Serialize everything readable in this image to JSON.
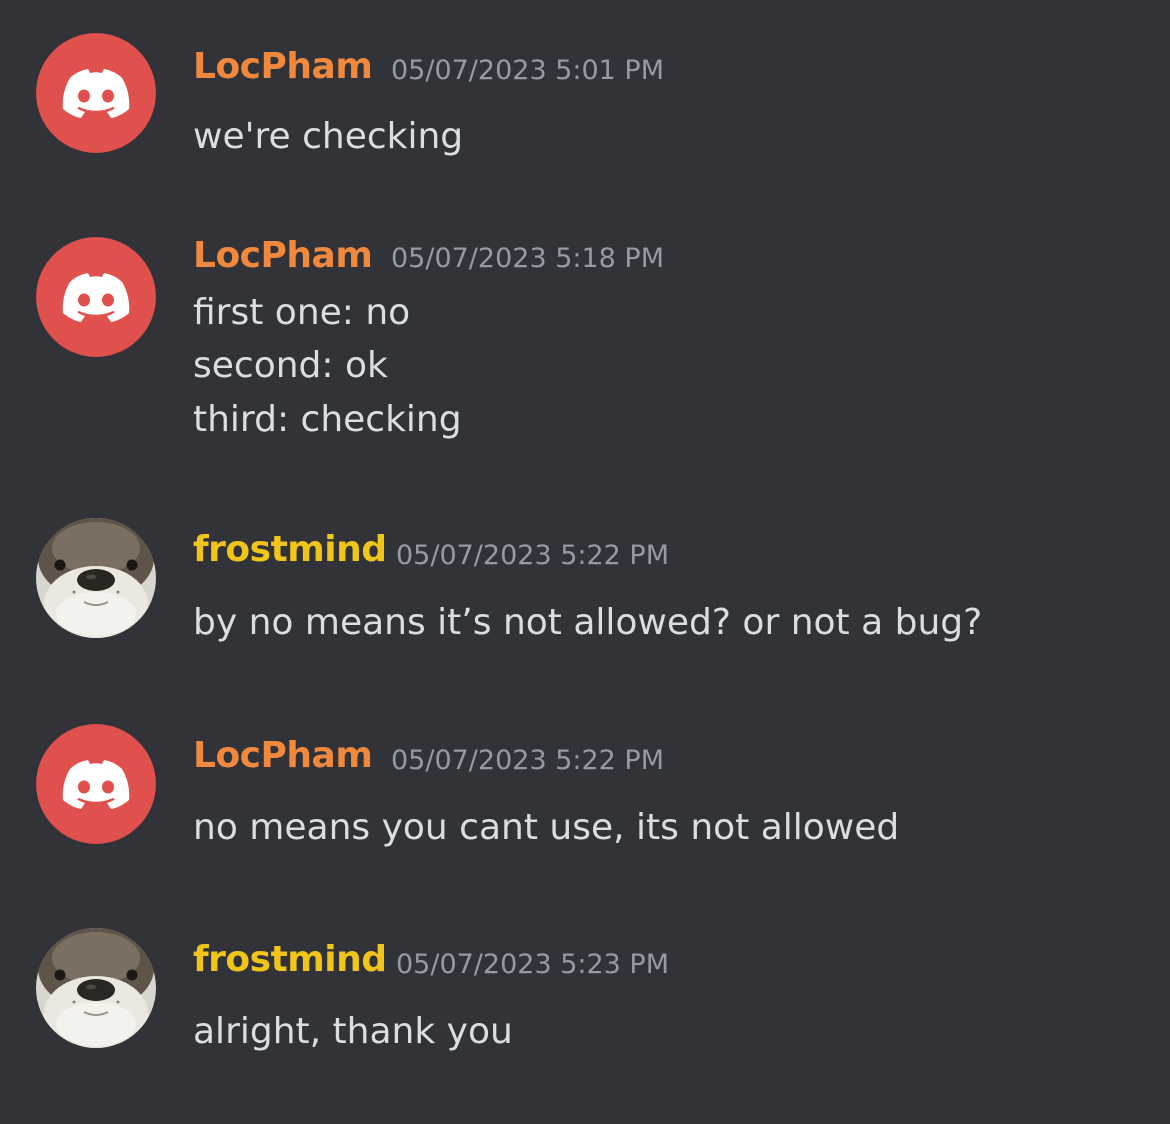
{
  "theme": {
    "background": "#313338",
    "text_color": "#dbdee1",
    "timestamp_color": "#949ba4",
    "discord_avatar_color": "#e0504c"
  },
  "messages": [
    {
      "author": "LocPham",
      "author_color": "#f0883e",
      "avatar_icon": "discord-logo-icon",
      "timestamp": "05/07/2023 5:01 PM",
      "lines": [
        "we're checking"
      ]
    },
    {
      "author": "LocPham",
      "author_color": "#f0883e",
      "avatar_icon": "discord-logo-icon",
      "timestamp": "05/07/2023 5:18 PM",
      "lines": [
        "first one: no",
        "second: ok",
        "third: checking"
      ]
    },
    {
      "author": "frostmind",
      "author_color": "#f0c419",
      "avatar_icon": "otter-photo",
      "timestamp": "05/07/2023 5:22 PM",
      "lines": [
        "by no means it’s not allowed? or not a bug?"
      ]
    },
    {
      "author": "LocPham",
      "author_color": "#f0883e",
      "avatar_icon": "discord-logo-icon",
      "timestamp": "05/07/2023 5:22 PM",
      "lines": [
        "no means you cant use, its not allowed"
      ]
    },
    {
      "author": "frostmind",
      "author_color": "#f0c419",
      "avatar_icon": "otter-photo",
      "timestamp": "05/07/2023 5:23 PM",
      "lines": [
        "alright, thank you"
      ]
    }
  ]
}
